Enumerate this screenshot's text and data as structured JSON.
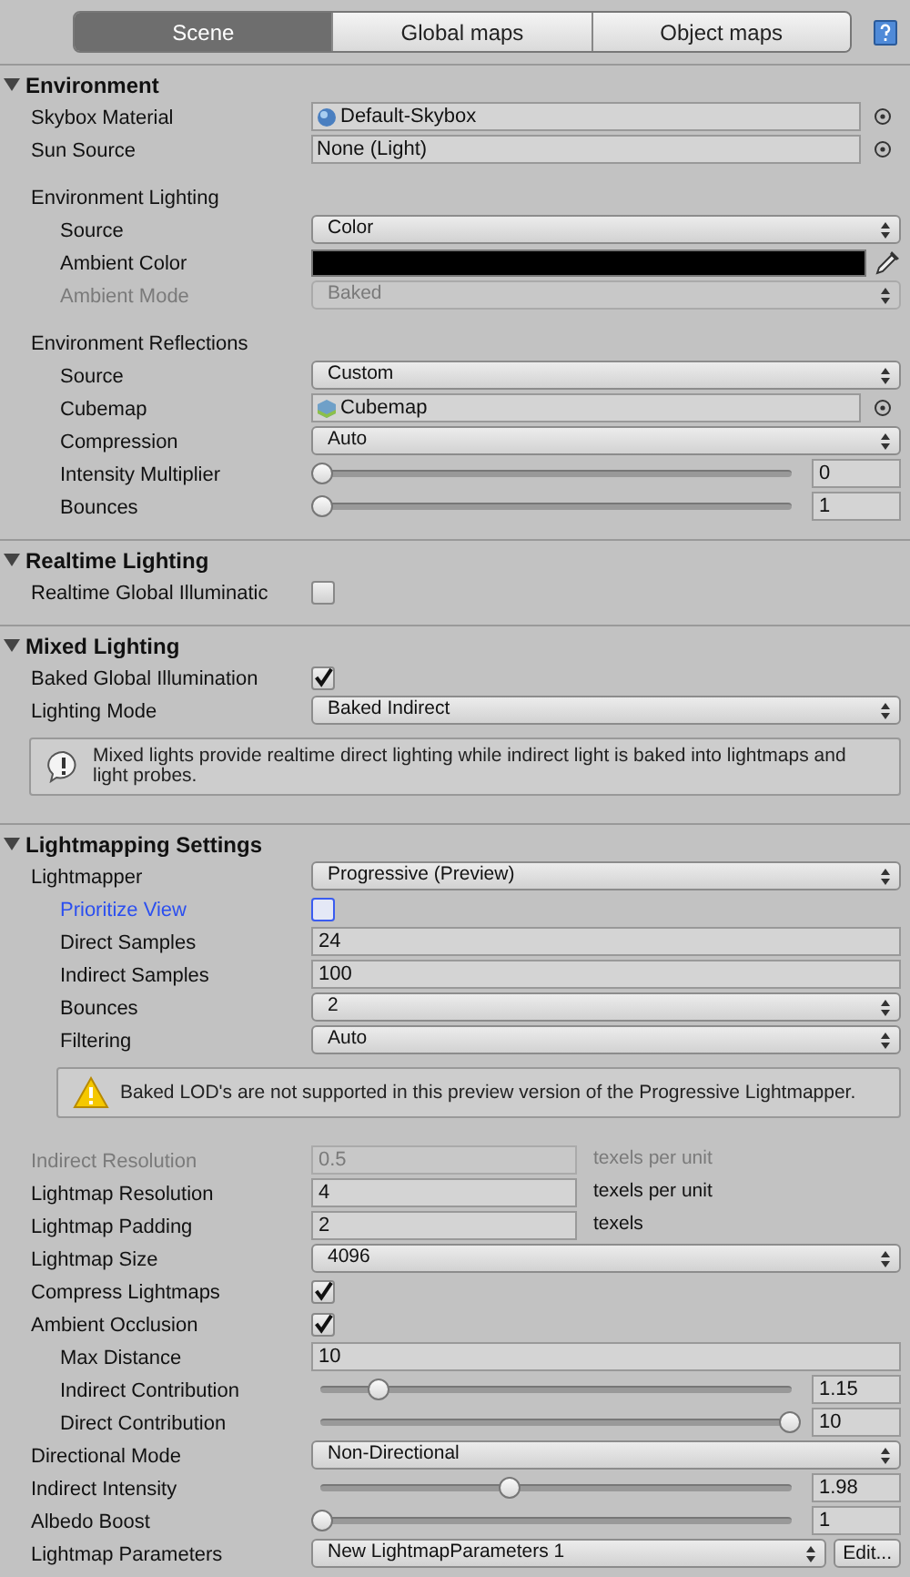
{
  "tabs": [
    {
      "label": "Scene",
      "selected": true
    },
    {
      "label": "Global maps",
      "selected": false
    },
    {
      "label": "Object maps",
      "selected": false
    }
  ],
  "sections": [
    {
      "title": "Environment",
      "expanded": true,
      "rows": [
        {
          "kind": "material",
          "label": "Skybox Material",
          "value": "Default-Skybox"
        },
        {
          "kind": "object",
          "label": "Sun Source",
          "value": "None (Light)"
        },
        {
          "kind": "heading",
          "label": "Environment Lighting",
          "children": [
            {
              "kind": "dropdown",
              "label": "Source",
              "value": "Color"
            },
            {
              "kind": "color",
              "label": "Ambient Color",
              "color": "#000000"
            },
            {
              "kind": "dropdown",
              "label": "Ambient Mode",
              "value": "Baked",
              "disabled": true
            }
          ]
        },
        {
          "kind": "heading",
          "label": "Environment Reflections",
          "children": [
            {
              "kind": "dropdown",
              "label": "Source",
              "value": "Custom"
            },
            {
              "kind": "cubemap",
              "label": "Cubemap",
              "value": "Cubemap"
            },
            {
              "kind": "dropdown",
              "label": "Compression",
              "value": "Auto"
            },
            {
              "kind": "slider",
              "label": "Intensity Multiplier",
              "level": 0,
              "value": "0"
            },
            {
              "kind": "slider",
              "label": "Bounces",
              "level": 0,
              "value": "1"
            }
          ]
        }
      ]
    },
    {
      "title": "Realtime Lighting",
      "expanded": true,
      "rows": [
        {
          "kind": "checkbox",
          "label": "Realtime Global Illuminatic",
          "checked": false
        }
      ]
    },
    {
      "title": "Mixed Lighting",
      "expanded": true,
      "rows": [
        {
          "kind": "checkbox",
          "label": "Baked Global Illumination",
          "checked": true
        },
        {
          "kind": "dropdown",
          "label": "Lighting Mode",
          "value": "Baked Indirect"
        },
        {
          "kind": "info",
          "text": "Mixed lights provide realtime direct lighting while indirect light is baked into lightmaps and light probes."
        }
      ]
    },
    {
      "title": "Lightmapping Settings",
      "expanded": true,
      "rows": [
        {
          "kind": "dropdown",
          "label": "Lightmapper",
          "value": "Progressive (Preview)",
          "children": [
            {
              "kind": "checkbox",
              "label": "Prioritize View",
              "checked": false,
              "highlighted": true
            },
            {
              "kind": "text",
              "label": "Direct Samples",
              "value": "24"
            },
            {
              "kind": "text",
              "label": "Indirect Samples",
              "value": "100"
            },
            {
              "kind": "dropdown",
              "label": "Bounces",
              "value": "2"
            },
            {
              "kind": "dropdown",
              "label": "Filtering",
              "value": "Auto"
            },
            {
              "kind": "warning",
              "text": "Baked LOD's are not supported in this preview version of the Progressive Lightmapper."
            }
          ]
        },
        {
          "kind": "text_unit",
          "label": "Indirect Resolution",
          "value": "0.5",
          "unit": "texels per unit",
          "disabled": true
        },
        {
          "kind": "text_unit",
          "label": "Lightmap Resolution",
          "value": "4",
          "unit": "texels per unit"
        },
        {
          "kind": "text_unit",
          "label": "Lightmap Padding",
          "value": "2",
          "unit": "texels"
        },
        {
          "kind": "dropdown",
          "label": "Lightmap Size",
          "value": "4096"
        },
        {
          "kind": "checkbox",
          "label": "Compress Lightmaps",
          "checked": true
        },
        {
          "kind": "checkbox",
          "label": "Ambient Occlusion",
          "checked": true,
          "children": [
            {
              "kind": "text",
              "label": "Max Distance",
              "value": "10"
            },
            {
              "kind": "slider",
              "label": "Indirect Contribution",
              "level": 0.12,
              "value": "1.15"
            },
            {
              "kind": "slider",
              "label": "Direct Contribution",
              "level": 1,
              "value": "10"
            }
          ]
        },
        {
          "kind": "dropdown",
          "label": "Directional Mode",
          "value": "Non-Directional"
        },
        {
          "kind": "slider",
          "label": "Indirect Intensity",
          "level": 0.4,
          "value": "1.98"
        },
        {
          "kind": "slider",
          "label": "Albedo Boost",
          "level": 0,
          "value": "1"
        },
        {
          "kind": "dropdown_button",
          "label": "Lightmap Parameters",
          "value": "New LightmapParameters 1",
          "button": "Edit..."
        }
      ]
    }
  ]
}
